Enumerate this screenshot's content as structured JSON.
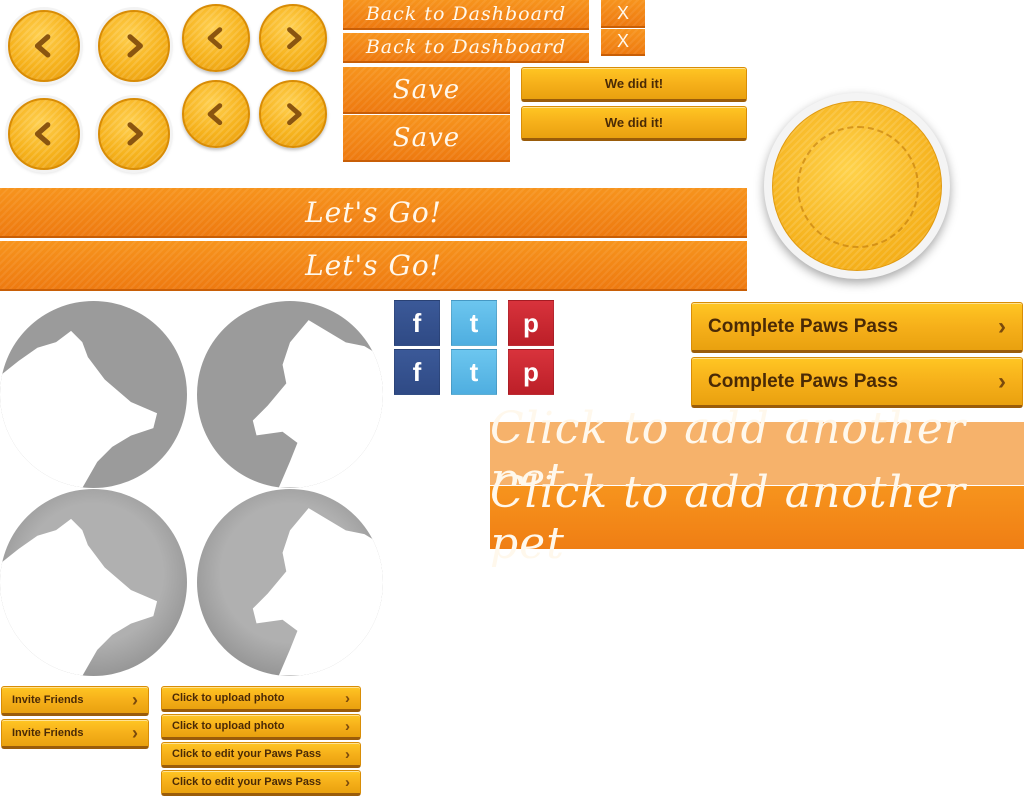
{
  "nav_buttons": {
    "prev_label": "‹",
    "next_label": "›"
  },
  "dashboard": {
    "back_label": "Back to Dashboard",
    "close_label": "X"
  },
  "save": {
    "label": "Save"
  },
  "celebrate": {
    "label": "We did it!"
  },
  "lets_go": {
    "label": "Let's Go!"
  },
  "paws_pass": {
    "complete_label": "Complete Paws Pass",
    "chevron": "›"
  },
  "add_pet": {
    "label": "Click to add another pet"
  },
  "social": {
    "facebook": "f",
    "twitter": "t",
    "pinterest": "p"
  },
  "small_buttons": {
    "invite_label": "Invite Friends",
    "upload_label": "Click to upload photo",
    "edit_label": "Click to edit your Paws Pass",
    "chevron": "›"
  },
  "colors": {
    "orange": "#f7941d",
    "gold": "#f6b01a",
    "brown_text": "#4a2a06",
    "dog_gray": "#9b9b9b"
  },
  "icons": [
    "chevron-left-icon",
    "chevron-right-icon",
    "facebook-icon",
    "twitter-icon",
    "pinterest-icon",
    "dog-silhouette-icon"
  ]
}
